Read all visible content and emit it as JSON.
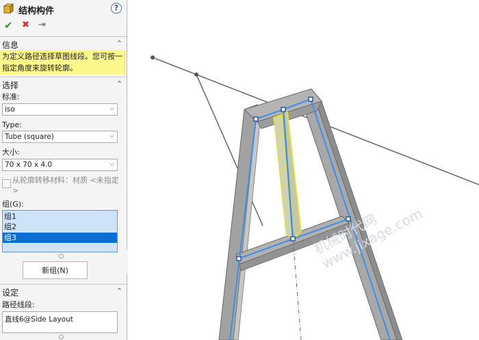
{
  "panel": {
    "title": "结构构件",
    "help": "?",
    "actions": {
      "ok": "✔",
      "cancel": "✖",
      "pin": "⇥"
    }
  },
  "info": {
    "heading": "信息",
    "text": "为定义路径选择草图线段。您可按一指定角度来旋转轮廓。"
  },
  "selection": {
    "heading": "选择",
    "standard_label": "标准:",
    "standard_value": "iso",
    "type_label": "Type:",
    "type_value": "Tube (square)",
    "size_label": "大小:",
    "size_value": "70 x 70 x 4.0",
    "transfer_material_label": "从轮廓转移材料：材质 <未指定>",
    "groups_label": "组(G):",
    "groups": [
      "组1",
      "组2",
      "组3"
    ],
    "selected_group": 2,
    "new_group_button": "新组(N)"
  },
  "settings": {
    "heading": "设定",
    "path_label": "路径线段:",
    "path_value": "直线6@Side Layout"
  },
  "watermark": {
    "line1": "机械时代网",
    "line2": "www.jixage.com"
  },
  "colors": {
    "info_bg": "#fdf88c",
    "selection_blue": "#0a6ed3",
    "list_bg": "#cfe3f8",
    "sketch_blue": "#3e8fe8",
    "highlight_yellow": "#f1f120",
    "frame_gray": "#8e8e8e"
  }
}
